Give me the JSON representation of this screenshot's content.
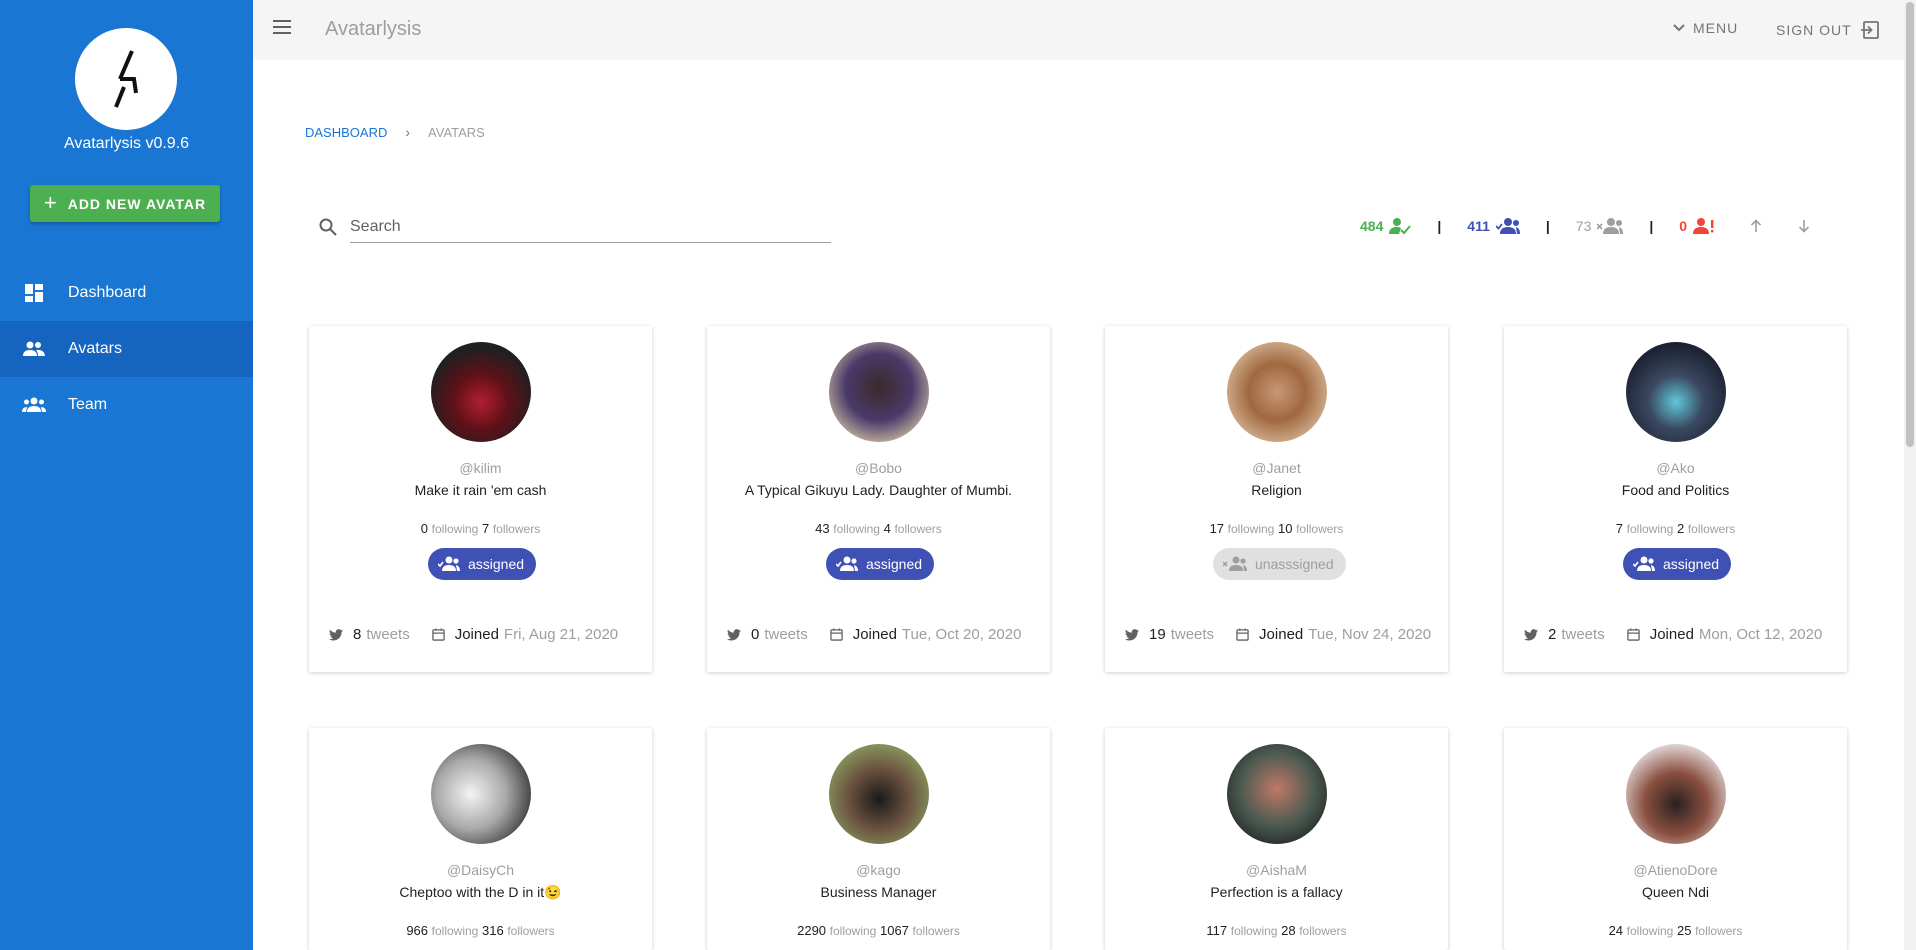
{
  "app": {
    "brand": "Avatarlysis",
    "version_label": "Avatarlysis v0.9.6"
  },
  "sidebar": {
    "add_button": "ADD NEW AVATAR",
    "items": [
      {
        "label": "Dashboard",
        "icon": "dashboard-icon"
      },
      {
        "label": "Avatars",
        "icon": "avatars-icon",
        "active": true
      },
      {
        "label": "Team",
        "icon": "team-icon"
      }
    ]
  },
  "topbar": {
    "menu_label": "MENU",
    "signout_label": "SIGN OUT"
  },
  "breadcrumb": {
    "link": "DASHBOARD",
    "separator": "›",
    "current": "AVATARS"
  },
  "search": {
    "placeholder": "Search",
    "value": ""
  },
  "stats": {
    "verified": "484",
    "assigned": "411",
    "unassigned": "73",
    "flagged": "0",
    "separator": "|",
    "colors": {
      "verified": "#4caf50",
      "assigned": "#3f51b5",
      "unassigned": "#9e9e9e",
      "flagged": "#f44336"
    }
  },
  "cards": [
    {
      "handle": "@kilim",
      "bio": "Make it rain 'em cash",
      "following": "0",
      "followers": "7",
      "status": "assigned",
      "tweets": "8",
      "joined_date": "Fri, Aug 21, 2020",
      "avatar_color": "#3a2020"
    },
    {
      "handle": "@Bobo",
      "bio": "A Typical Gikuyu Lady. Daughter of Mumbi.",
      "following": "43",
      "followers": "4",
      "status": "assigned",
      "tweets": "0",
      "joined_date": "Tue, Oct 20, 2020",
      "avatar_color": "#4a3a5a"
    },
    {
      "handle": "@Janet",
      "bio": "Religion",
      "following": "17",
      "followers": "10",
      "status": "unasssigned",
      "tweets": "19",
      "joined_date": "Tue, Nov 24, 2020",
      "avatar_color": "#b07040"
    },
    {
      "handle": "@Ako",
      "bio": "Food and Politics",
      "following": "7",
      "followers": "2",
      "status": "assigned",
      "tweets": "2",
      "joined_date": "Mon, Oct 12, 2020",
      "avatar_color": "#2a3040"
    },
    {
      "handle": "@DaisyCh",
      "bio": "Cheptoo with the D in it😉",
      "following": "966",
      "followers": "316",
      "avatar_color": "#d8d8d8"
    },
    {
      "handle": "@kago",
      "bio": "Business Manager",
      "following": "2290",
      "followers": "1067",
      "avatar_color": "#6a5040"
    },
    {
      "handle": "@AishaM",
      "bio": "Perfection is a fallacy",
      "following": "117",
      "followers": "28",
      "avatar_color": "#4a5a50"
    },
    {
      "handle": "@AtienoDore",
      "bio": "Queen Ndi",
      "following": "24",
      "followers": "25",
      "avatar_color": "#8a3030"
    }
  ],
  "card_labels": {
    "following": "following",
    "followers": "followers",
    "tweets": "tweets",
    "joined": "Joined"
  }
}
